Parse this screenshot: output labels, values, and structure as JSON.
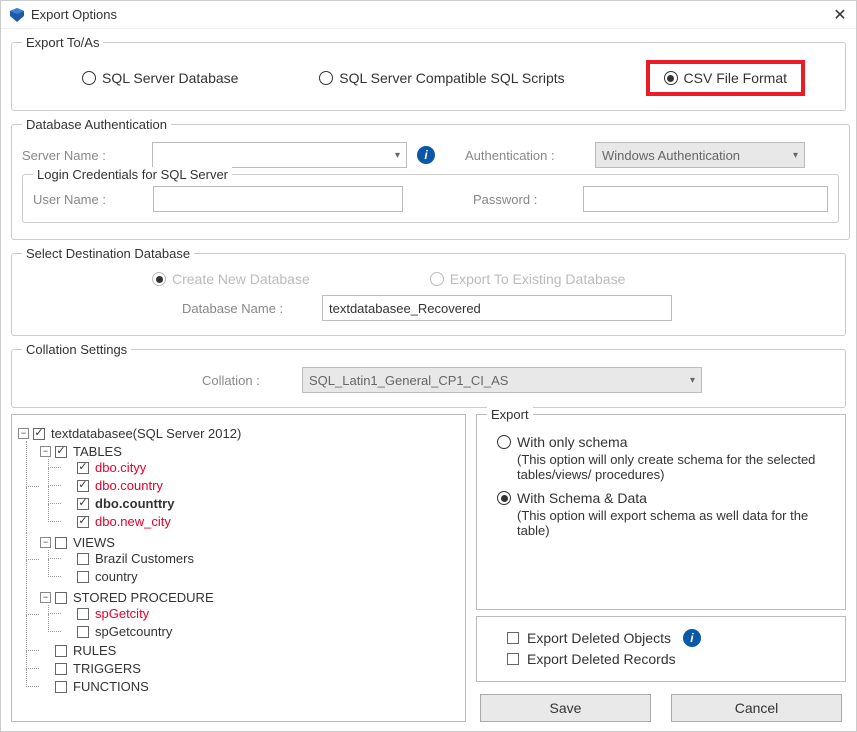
{
  "window": {
    "title": "Export Options"
  },
  "exportToAs": {
    "legend": "Export To/As",
    "options": {
      "sql_db": "SQL Server Database",
      "sql_scripts": "SQL Server Compatible SQL Scripts",
      "csv": "CSV File Format"
    },
    "selected": "csv"
  },
  "dbAuth": {
    "legend": "Database Authentication",
    "serverNameLabel": "Server Name :",
    "serverNameValue": "",
    "authLabel": "Authentication :",
    "authValue": "Windows Authentication"
  },
  "loginCreds": {
    "legend": "Login Credentials for SQL Server",
    "userLabel": "User Name :",
    "userValue": "",
    "passLabel": "Password :",
    "passValue": ""
  },
  "destDb": {
    "legend": "Select Destination Database",
    "createLabel": "Create New Database",
    "existingLabel": "Export To Existing Database",
    "dbNameLabel": "Database Name :",
    "dbNameValue": "textdatabasee_Recovered"
  },
  "collation": {
    "legend": "Collation Settings",
    "label": "Collation :",
    "value": "SQL_Latin1_General_CP1_CI_AS"
  },
  "tree": {
    "root": {
      "label": "textdatabasee(SQL Server 2012)",
      "checked": true
    },
    "tables": {
      "label": "TABLES",
      "checked": true,
      "items": [
        {
          "label": "dbo.cityy",
          "checked": true,
          "red": true
        },
        {
          "label": "dbo.country",
          "checked": true,
          "red": true
        },
        {
          "label": "dbo.counttry",
          "checked": true,
          "bold": true
        },
        {
          "label": "dbo.new_city",
          "checked": true,
          "red": true
        }
      ]
    },
    "views": {
      "label": "VIEWS",
      "checked": false,
      "items": [
        {
          "label": "Brazil Customers",
          "checked": false
        },
        {
          "label": "country",
          "checked": false
        }
      ]
    },
    "sprocs": {
      "label": "STORED PROCEDURE",
      "checked": false,
      "items": [
        {
          "label": "spGetcity",
          "checked": false,
          "red": true
        },
        {
          "label": "spGetcountry",
          "checked": false
        }
      ]
    },
    "rules": {
      "label": "RULES",
      "checked": false
    },
    "triggers": {
      "label": "TRIGGERS",
      "checked": false
    },
    "functions": {
      "label": "FUNCTIONS",
      "checked": false
    }
  },
  "exportOpts": {
    "legend": "Export",
    "schemaOnly": {
      "label": "With only schema",
      "desc": "(This option will only create schema for the  selected tables/views/ procedures)"
    },
    "schemaData": {
      "label": "With Schema & Data",
      "desc": "(This option will export schema as well data for the table)"
    },
    "selected": "schemaData",
    "deletedObjects": "Export Deleted Objects",
    "deletedRecords": "Export Deleted Records"
  },
  "buttons": {
    "save": "Save",
    "cancel": "Cancel"
  }
}
